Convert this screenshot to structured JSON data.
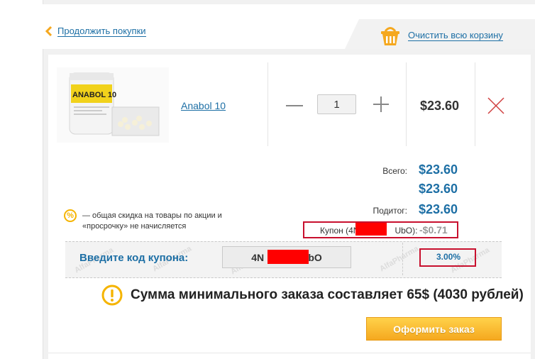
{
  "nav": {
    "continue_label": "Продолжить покупки",
    "clear_label": "Очистить всю корзину",
    "back_icon": "chevron-left-icon",
    "basket_icon": "basket-icon"
  },
  "cart": {
    "items": [
      {
        "name": "Anabol 10",
        "quantity": "1",
        "price": "$23.60",
        "image_label": "ANABOL 10"
      }
    ]
  },
  "summary": {
    "total_label": "Всего:",
    "total_value": "$23.60",
    "second_value": "$23.60",
    "subtotal_label": "Подитог:",
    "subtotal_value": "$23.60",
    "coupon_line_label": "Купон (4N               UbO):",
    "coupon_discount": "-$0.71"
  },
  "note": {
    "icon": "%",
    "text": "— общая скидка на товары по акции и «просрочку» не начисляется"
  },
  "coupon": {
    "prompt": "Введите код купона:",
    "code": "4N                bO",
    "percent": "3.00%"
  },
  "warning": {
    "text": "Сумма минимального заказа составляет 65$ (4030 рублей)"
  },
  "order": {
    "button_label": "Оформить заказ"
  },
  "colors": {
    "link": "#1d6fa5",
    "accent": "#f5a81f",
    "highlight_border": "#c8102e"
  }
}
